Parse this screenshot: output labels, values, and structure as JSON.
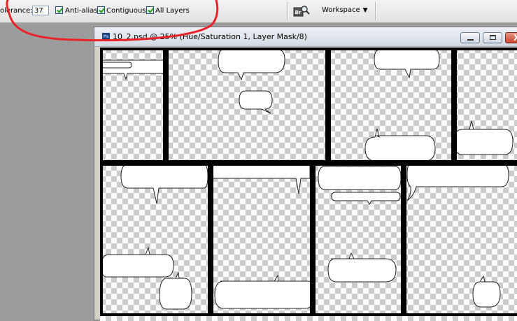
{
  "options_bar": {
    "tolerance_label": "olerance:",
    "tolerance_value": "37",
    "anti_alias_label": "Anti-alias",
    "contiguous_label": "Contiguous",
    "all_layers_label": "All Layers",
    "bridge_icon_label": "Br",
    "workspace_label": "Workspace",
    "workspace_arrow": "▼"
  },
  "document": {
    "title": "10_2.psd @ 25% (Hue/Saturation 1, Layer Mask/8)",
    "icon_label": "Ps",
    "close_glyph": "X"
  },
  "colors": {
    "annotation": "#e8242a",
    "panel_border": "#000000",
    "checker_light": "#ffffff",
    "checker_dark": "#cccccc"
  }
}
